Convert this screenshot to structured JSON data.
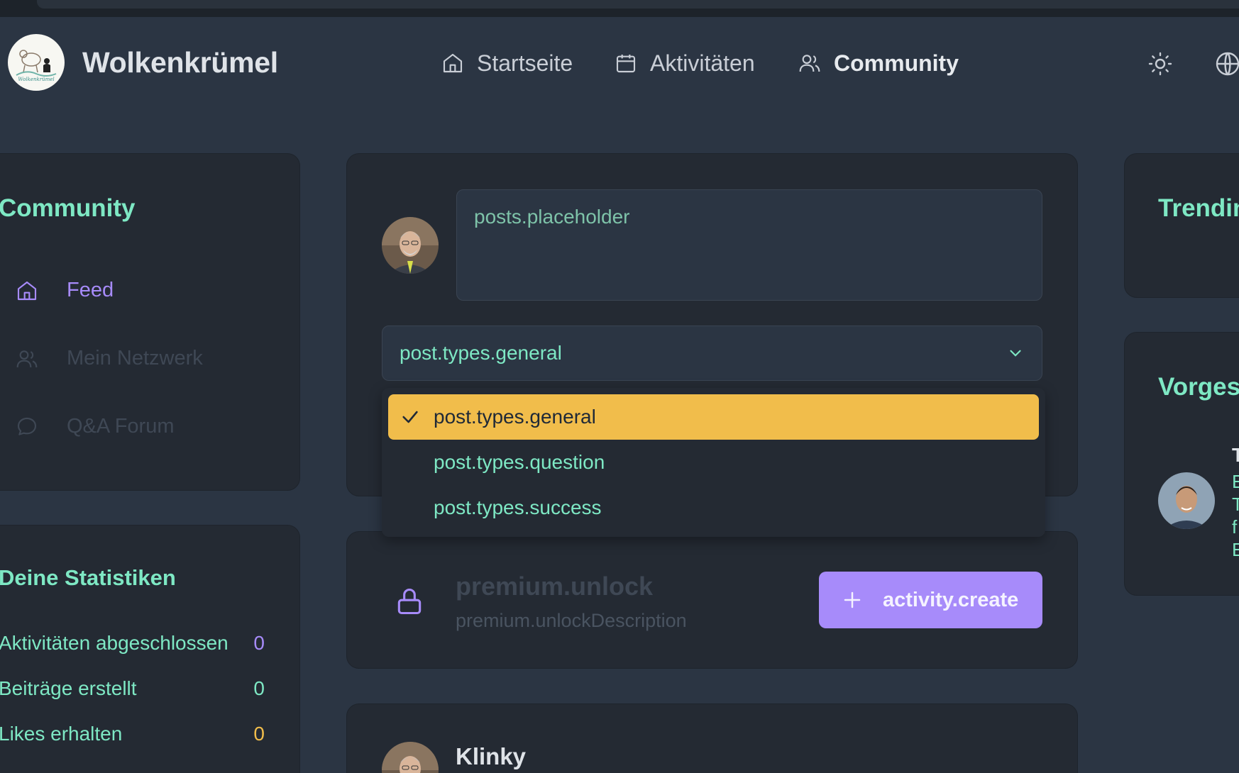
{
  "app": {
    "name": "Wolkenkrümel",
    "logo_text": "Wolkenkrümel"
  },
  "nav": [
    {
      "label": "Startseite",
      "icon": "home-icon"
    },
    {
      "label": "Aktivitäten",
      "icon": "calendar-icon"
    },
    {
      "label": "Community",
      "icon": "users-icon",
      "active": true
    }
  ],
  "header_icons": [
    "sun-icon",
    "globe-icon"
  ],
  "sidebar": {
    "title": "Community",
    "items": [
      {
        "label": "Feed",
        "icon": "home-icon",
        "active": true
      },
      {
        "label": "Mein Netzwerk",
        "icon": "users-icon"
      },
      {
        "label": "Q&A Forum",
        "icon": "chat-bubble-icon"
      }
    ]
  },
  "stats": {
    "title": "Deine Statistiken",
    "rows": [
      {
        "label": "Aktivitäten abgeschlossen",
        "value": "0",
        "color": "#a78bfa"
      },
      {
        "label": "Beiträge erstellt",
        "value": "0",
        "color": "#7ee8c4"
      },
      {
        "label": "Likes erhalten",
        "value": "0",
        "color": "#f1bd4b"
      }
    ]
  },
  "composer": {
    "placeholder": "posts.placeholder",
    "select_value": "post.types.general",
    "options": [
      "post.types.general",
      "post.types.question",
      "post.types.success"
    ],
    "selected_option": "post.types.general"
  },
  "premium": {
    "title": "premium.unlock",
    "description": "premium.unlockDescription",
    "button_label": "activity.create"
  },
  "post": {
    "author": "Klinky",
    "menu": "..."
  },
  "right": {
    "trending_title": "Trendin",
    "suggested_title": "Vorges",
    "suggested_name_initial": "T",
    "suggested_lines": [
      "E",
      "T",
      "f",
      "E"
    ]
  },
  "colors": {
    "background": "#2b3543",
    "card": "#242a33",
    "accent_green": "#7ee8c4",
    "accent_purple": "#a78bfa",
    "accent_yellow": "#f1bd4b"
  }
}
